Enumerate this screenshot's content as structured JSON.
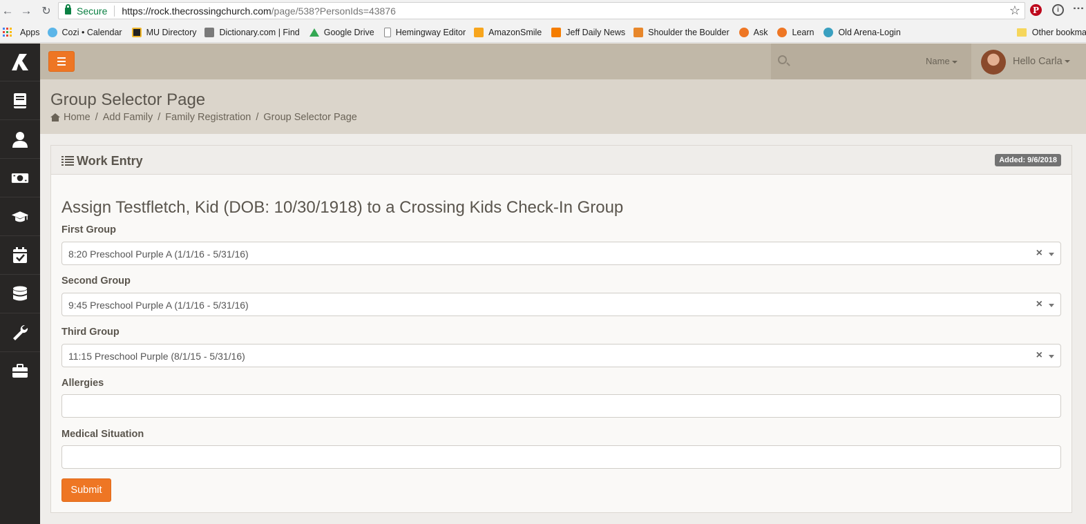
{
  "browser": {
    "secure_label": "Secure",
    "url_host": "https://rock.thecrossingchurch.com",
    "url_path": "/page/538?PersonIds=43876",
    "bookmarks": [
      {
        "label": "Apps",
        "icon": "apps-grid-icon",
        "color": "#4285f4"
      },
      {
        "label": "Cozi • Calendar",
        "icon": "cozi-icon",
        "color": "#5bb5e8"
      },
      {
        "label": "MU Directory",
        "icon": "mu-tiger-icon",
        "color": "#222222"
      },
      {
        "label": "Dictionary.com | Find",
        "icon": "dictionary-icon",
        "color": "#7a7a7a"
      },
      {
        "label": "Google Drive",
        "icon": "google-drive-icon",
        "color": "#34a853"
      },
      {
        "label": "Hemingway Editor",
        "icon": "page-icon",
        "color": "#ffffff"
      },
      {
        "label": "AmazonSmile",
        "icon": "amazon-icon",
        "color": "#f7a51d"
      },
      {
        "label": "Jeff Daily News",
        "icon": "blogger-icon",
        "color": "#f57d00"
      },
      {
        "label": "Shoulder the Boulder",
        "icon": "boulder-icon",
        "color": "#e8872b"
      },
      {
        "label": "Ask",
        "icon": "rock-icon",
        "color": "#ee7624"
      },
      {
        "label": "Learn",
        "icon": "rock-icon",
        "color": "#ee7624"
      },
      {
        "label": "Old Arena-Login",
        "icon": "arena-icon",
        "color": "#3aa0c0"
      }
    ],
    "other_bookmarks": "Other bookmarks"
  },
  "sidebar": {
    "items": [
      {
        "name": "sidebar-item-pages",
        "icon": "book-icon"
      },
      {
        "name": "sidebar-item-people",
        "icon": "person-icon"
      },
      {
        "name": "sidebar-item-finance",
        "icon": "money-icon"
      },
      {
        "name": "sidebar-item-learning",
        "icon": "graduation-cap-icon"
      },
      {
        "name": "sidebar-item-calendar",
        "icon": "calendar-check-icon"
      },
      {
        "name": "sidebar-item-data",
        "icon": "database-icon"
      },
      {
        "name": "sidebar-item-tools",
        "icon": "wrench-icon"
      },
      {
        "name": "sidebar-item-admin",
        "icon": "briefcase-icon"
      }
    ]
  },
  "topnav": {
    "search_filter": "Name",
    "greeting": "Hello Carla"
  },
  "header": {
    "title": "Group Selector Page",
    "breadcrumbs": [
      "Home",
      "Add Family",
      "Family Registration",
      "Group Selector Page"
    ]
  },
  "panel": {
    "title": "Work Entry",
    "badge": "Added: 9/6/2018",
    "heading": "Assign Testfletch, Kid (DOB: 10/30/1918) to a Crossing Kids Check-In Group",
    "fields": {
      "first_group": {
        "label": "First Group",
        "value": "8:20 Preschool Purple A (1/1/16 - 5/31/16)"
      },
      "second_group": {
        "label": "Second Group",
        "value": "9:45 Preschool Purple A (1/1/16 - 5/31/16)"
      },
      "third_group": {
        "label": "Third Group",
        "value": "11:15 Preschool Purple (8/1/15 - 5/31/16)"
      },
      "allergies": {
        "label": "Allergies",
        "value": ""
      },
      "medical": {
        "label": "Medical Situation",
        "value": ""
      }
    },
    "submit_label": "Submit"
  },
  "colors": {
    "accent": "#ee7624",
    "sidebar_bg": "#282625",
    "topnav_bg": "#c1b8a8",
    "header_bg": "#dbd5cb"
  }
}
